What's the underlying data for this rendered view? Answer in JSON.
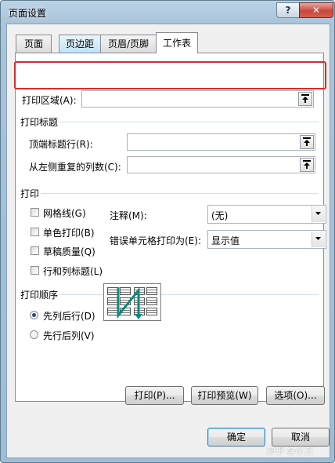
{
  "window": {
    "title": "页面设置",
    "help": "?",
    "close": "✕"
  },
  "tabs": [
    {
      "label": "页面"
    },
    {
      "label": "页边距"
    },
    {
      "label": "页眉/页脚"
    },
    {
      "label": "工作表"
    }
  ],
  "print_area": {
    "label": "打印区域(A):",
    "value": ""
  },
  "print_titles": {
    "heading": "打印标题",
    "top_rows_label": "顶端标题行(R):",
    "top_rows_value": "",
    "left_cols_label": "从左侧重复的列数(C):",
    "left_cols_value": ""
  },
  "print": {
    "heading": "打印",
    "gridlines": "网格线(G)",
    "black_white": "单色打印(B)",
    "draft": "草稿质量(Q)",
    "row_col_headings": "行和列标题(L)",
    "comments_label": "注释(M):",
    "comments_value": "(无)",
    "errors_label": "错误单元格打印为(E):",
    "errors_value": "显示值"
  },
  "page_order": {
    "heading": "打印顺序",
    "down_then_over": "先列后行(D)",
    "over_then_down": "先行后列(V)",
    "selected": "down_then_over"
  },
  "buttons": {
    "print": "打印(P)...",
    "print_preview": "打印预览(W)",
    "options": "选项(O)...",
    "ok": "确定",
    "cancel": "取消"
  },
  "watermark": "知乎 @小卫",
  "colors": {
    "highlight": "#d52b2b",
    "arrow": "#0f8a7a"
  }
}
